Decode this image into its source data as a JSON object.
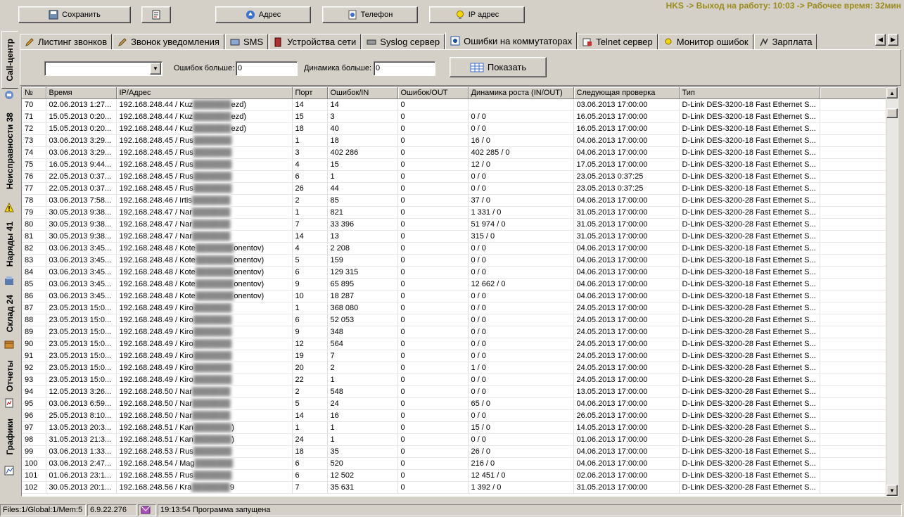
{
  "toolbar": {
    "save_label": "Сохранить",
    "address_label": "Адрес",
    "phone_label": "Телефон",
    "ip_label": "IP адрес",
    "status": "HKS -> Выход на работу: 10:03 -> Рабочее время: 32мин"
  },
  "side_tabs": [
    "Call-центр",
    "Неисправности 38",
    "Наряды 41",
    "Склад 24",
    "Отчеты",
    "Графики"
  ],
  "tabs": [
    "Листинг звонков",
    "Звонок уведомления",
    "SMS",
    "Устройства сети",
    "Syslog сервер",
    "Ошибки на коммутаторах",
    "Telnet сервер",
    "Монитор ошибок",
    "Зарплата"
  ],
  "filter": {
    "errors_label": "Ошибок больше:",
    "errors_value": "0",
    "dynamics_label": "Динамика больше:",
    "dynamics_value": "0",
    "show_label": "Показать"
  },
  "columns": [
    "№",
    "Время",
    "IP/Адрес",
    "Порт",
    "Ошибок/IN",
    "Ошибок/OUT",
    "Динамика роста (IN/OUT)",
    "Следующая проверка",
    "Тип"
  ],
  "rows": [
    [
      "70",
      "02.06.2013 1:27...",
      "192.168.248.44 / Kuz",
      "ezd)",
      "14",
      "14",
      "0",
      "",
      "03.06.2013 17:00:00",
      "D-Link DES-3200-18 Fast Ethernet S..."
    ],
    [
      "71",
      "15.05.2013 0:20...",
      "192.168.248.44 / Kuz",
      "ezd)",
      "15",
      "3",
      "0",
      "0 / 0",
      "16.05.2013 17:00:00",
      "D-Link DES-3200-18 Fast Ethernet S..."
    ],
    [
      "72",
      "15.05.2013 0:20...",
      "192.168.248.44 / Kuz",
      "ezd)",
      "18",
      "40",
      "0",
      "0 / 0",
      "16.05.2013 17:00:00",
      "D-Link DES-3200-18 Fast Ethernet S..."
    ],
    [
      "73",
      "03.06.2013 3:29...",
      "192.168.248.45 / Rus",
      "",
      "1",
      "18",
      "0",
      "16 / 0",
      "04.06.2013 17:00:00",
      "D-Link DES-3200-18 Fast Ethernet S..."
    ],
    [
      "74",
      "03.06.2013 3:29...",
      "192.168.248.45 / Rus",
      "",
      "3",
      "402 286",
      "0",
      "402 285 / 0",
      "04.06.2013 17:00:00",
      "D-Link DES-3200-18 Fast Ethernet S..."
    ],
    [
      "75",
      "16.05.2013 9:44...",
      "192.168.248.45 / Rus",
      "",
      "4",
      "15",
      "0",
      "12 / 0",
      "17.05.2013 17:00:00",
      "D-Link DES-3200-18 Fast Ethernet S..."
    ],
    [
      "76",
      "22.05.2013 0:37...",
      "192.168.248.45 / Rus",
      "",
      "6",
      "1",
      "0",
      "0 / 0",
      "23.05.2013 0:37:25",
      "D-Link DES-3200-18 Fast Ethernet S..."
    ],
    [
      "77",
      "22.05.2013 0:37...",
      "192.168.248.45 / Rus",
      "",
      "26",
      "44",
      "0",
      "0 / 0",
      "23.05.2013 0:37:25",
      "D-Link DES-3200-18 Fast Ethernet S..."
    ],
    [
      "78",
      "03.06.2013 7:58...",
      "192.168.248.46 / Irtis",
      "",
      "2",
      "85",
      "0",
      "37 / 0",
      "04.06.2013 17:00:00",
      "D-Link DES-3200-28 Fast Ethernet S..."
    ],
    [
      "79",
      "30.05.2013 9:38...",
      "192.168.248.47 / Nar",
      "",
      "1",
      "821",
      "0",
      "1 331 / 0",
      "31.05.2013 17:00:00",
      "D-Link DES-3200-28 Fast Ethernet S..."
    ],
    [
      "80",
      "30.05.2013 9:38...",
      "192.168.248.47 / Nar",
      "",
      "7",
      "33 396",
      "0",
      "51 974 / 0",
      "31.05.2013 17:00:00",
      "D-Link DES-3200-28 Fast Ethernet S..."
    ],
    [
      "81",
      "30.05.2013 9:38...",
      "192.168.248.47 / Nar",
      "",
      "14",
      "13",
      "0",
      "315 / 0",
      "31.05.2013 17:00:00",
      "D-Link DES-3200-28 Fast Ethernet S..."
    ],
    [
      "82",
      "03.06.2013 3:45...",
      "192.168.248.48 / Kote",
      "onentov)",
      "4",
      "2 208",
      "0",
      "0 / 0",
      "04.06.2013 17:00:00",
      "D-Link DES-3200-18 Fast Ethernet S..."
    ],
    [
      "83",
      "03.06.2013 3:45...",
      "192.168.248.48 / Kote",
      "onentov)",
      "5",
      "159",
      "0",
      "0 / 0",
      "04.06.2013 17:00:00",
      "D-Link DES-3200-18 Fast Ethernet S..."
    ],
    [
      "84",
      "03.06.2013 3:45...",
      "192.168.248.48 / Kote",
      "onentov)",
      "6",
      "129 315",
      "0",
      "0 / 0",
      "04.06.2013 17:00:00",
      "D-Link DES-3200-18 Fast Ethernet S..."
    ],
    [
      "85",
      "03.06.2013 3:45...",
      "192.168.248.48 / Kote",
      "onentov)",
      "9",
      "65 895",
      "0",
      "12 662 / 0",
      "04.06.2013 17:00:00",
      "D-Link DES-3200-18 Fast Ethernet S..."
    ],
    [
      "86",
      "03.06.2013 3:45...",
      "192.168.248.48 / Kote",
      "onentov)",
      "10",
      "18 287",
      "0",
      "0 / 0",
      "04.06.2013 17:00:00",
      "D-Link DES-3200-18 Fast Ethernet S..."
    ],
    [
      "87",
      "23.05.2013 15:0...",
      "192.168.248.49 / Kiro",
      "",
      "1",
      "368 080",
      "0",
      "0 / 0",
      "24.05.2013 17:00:00",
      "D-Link DES-3200-28 Fast Ethernet S..."
    ],
    [
      "88",
      "23.05.2013 15:0...",
      "192.168.248.49 / Kiro",
      "",
      "6",
      "52 053",
      "0",
      "0 / 0",
      "24.05.2013 17:00:00",
      "D-Link DES-3200-28 Fast Ethernet S..."
    ],
    [
      "89",
      "23.05.2013 15:0...",
      "192.168.248.49 / Kiro",
      "",
      "9",
      "348",
      "0",
      "0 / 0",
      "24.05.2013 17:00:00",
      "D-Link DES-3200-28 Fast Ethernet S..."
    ],
    [
      "90",
      "23.05.2013 15:0...",
      "192.168.248.49 / Kiro",
      "",
      "12",
      "564",
      "0",
      "0 / 0",
      "24.05.2013 17:00:00",
      "D-Link DES-3200-28 Fast Ethernet S..."
    ],
    [
      "91",
      "23.05.2013 15:0...",
      "192.168.248.49 / Kiro",
      "",
      "19",
      "7",
      "0",
      "0 / 0",
      "24.05.2013 17:00:00",
      "D-Link DES-3200-28 Fast Ethernet S..."
    ],
    [
      "92",
      "23.05.2013 15:0...",
      "192.168.248.49 / Kiro",
      "",
      "20",
      "2",
      "0",
      "1 / 0",
      "24.05.2013 17:00:00",
      "D-Link DES-3200-28 Fast Ethernet S..."
    ],
    [
      "93",
      "23.05.2013 15:0...",
      "192.168.248.49 / Kiro",
      "",
      "22",
      "1",
      "0",
      "0 / 0",
      "24.05.2013 17:00:00",
      "D-Link DES-3200-28 Fast Ethernet S..."
    ],
    [
      "94",
      "12.05.2013 3:26...",
      "192.168.248.50 / Nar",
      "",
      "2",
      "548",
      "0",
      "0 / 0",
      "13.05.2013 17:00:00",
      "D-Link DES-3200-28 Fast Ethernet S..."
    ],
    [
      "95",
      "03.06.2013 6:59...",
      "192.168.248.50 / Nar",
      "",
      "5",
      "24",
      "0",
      "65 / 0",
      "04.06.2013 17:00:00",
      "D-Link DES-3200-28 Fast Ethernet S..."
    ],
    [
      "96",
      "25.05.2013 8:10...",
      "192.168.248.50 / Nar",
      "",
      "14",
      "16",
      "0",
      "0 / 0",
      "26.05.2013 17:00:00",
      "D-Link DES-3200-28 Fast Ethernet S..."
    ],
    [
      "97",
      "13.05.2013 20:3...",
      "192.168.248.51 / Kan",
      ")",
      "1",
      "1",
      "0",
      "15 / 0",
      "14.05.2013 17:00:00",
      "D-Link DES-3200-28 Fast Ethernet S..."
    ],
    [
      "98",
      "31.05.2013 21:3...",
      "192.168.248.51 / Kan",
      ")",
      "24",
      "1",
      "0",
      "0 / 0",
      "01.06.2013 17:00:00",
      "D-Link DES-3200-28 Fast Ethernet S..."
    ],
    [
      "99",
      "03.06.2013 1:33...",
      "192.168.248.53 / Rus",
      "",
      "18",
      "35",
      "0",
      "26 / 0",
      "04.06.2013 17:00:00",
      "D-Link DES-3200-18 Fast Ethernet S..."
    ],
    [
      "100",
      "03.06.2013 2:47...",
      "192.168.248.54 / Mag",
      "",
      "6",
      "520",
      "0",
      "216 / 0",
      "04.06.2013 17:00:00",
      "D-Link DES-3200-28 Fast Ethernet S..."
    ],
    [
      "101",
      "01.06.2013 23:1...",
      "192.168.248.55 / Rus",
      "",
      "6",
      "12 502",
      "0",
      "12 451 / 0",
      "02.06.2013 17:00:00",
      "D-Link DES-3200-18 Fast Ethernet S..."
    ],
    [
      "102",
      "30.05.2013 20:1...",
      "192.168.248.56 / Kra",
      "9",
      "7",
      "35 631",
      "0",
      "1 392 / 0",
      "31.05.2013 17:00:00",
      "D-Link DES-3200-28 Fast Ethernet S..."
    ]
  ],
  "statusbar": {
    "files": "Files:1/Global:1/Mem:5",
    "version": "6.9.22.276",
    "message": "19:13:54 Программа запущена"
  },
  "colors": {
    "status_text": "#9a8a1a",
    "window_bg": "#d4d0c8"
  }
}
